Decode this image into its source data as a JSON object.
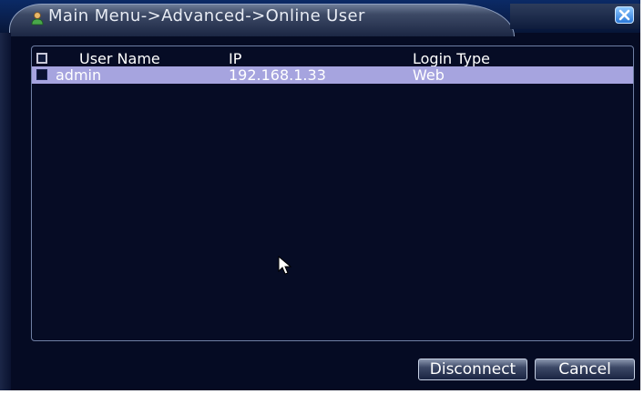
{
  "window": {
    "title": "Main Menu->Advanced->Online User",
    "close_icon": "close-icon",
    "title_icon": "online-user-icon"
  },
  "table": {
    "columns": [
      "User Name",
      "IP",
      "Login Type"
    ],
    "rows": [
      {
        "user_name": "admin",
        "ip": "192.168.1.33",
        "login_type": "Web",
        "selected": true
      }
    ]
  },
  "buttons": {
    "disconnect_label": "Disconnect",
    "cancel_label": "Cancel"
  },
  "colors": {
    "background": "#050b23",
    "selected_row": "#a6a4df",
    "text": "#ffffff"
  }
}
